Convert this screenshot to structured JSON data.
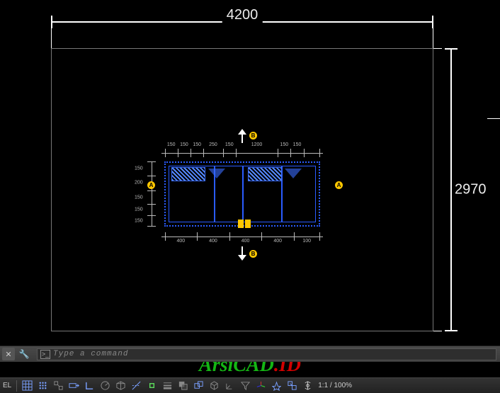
{
  "dimensions": {
    "width": "4200",
    "height": "2970"
  },
  "floorplan": {
    "top_dims": [
      "150",
      "150",
      "150",
      "250",
      "150",
      "1200",
      "150",
      "150"
    ],
    "bottom_dims": [
      "400",
      "400",
      "400",
      "400",
      "100"
    ],
    "left_dims": [
      "150",
      "200",
      "150",
      "150",
      "150"
    ],
    "grid_markers": {
      "A": "A",
      "B": "B"
    }
  },
  "command": {
    "placeholder": "Type a command"
  },
  "watermark": {
    "part1": "ArsiCAD",
    "part2": ".ID"
  },
  "status": {
    "model_label": "EL",
    "scale": "1:1 / 100%"
  }
}
